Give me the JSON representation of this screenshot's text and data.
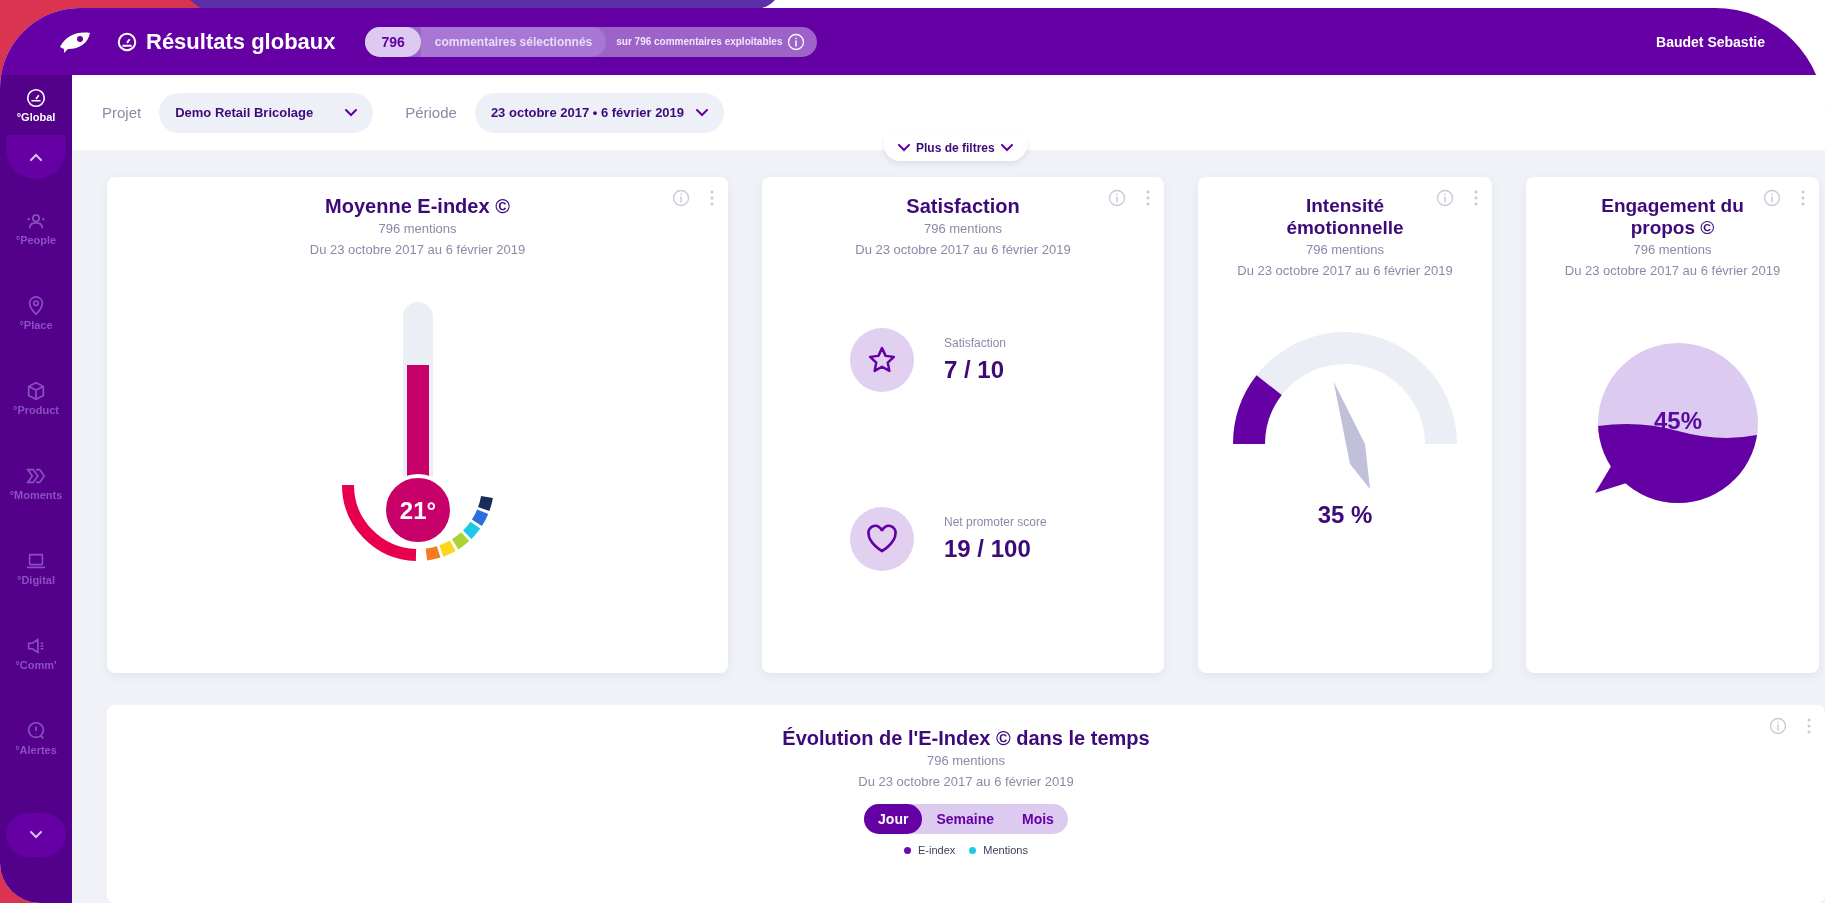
{
  "header": {
    "title": "Résultats globaux",
    "count": "796",
    "count_label": "commentaires sélectionnés",
    "total": "sur 796 commentaires exploitables",
    "user": "Baudet Sebastie"
  },
  "sidebar": {
    "items": [
      {
        "label": "°Global",
        "selected": true
      },
      {
        "label": "°People",
        "selected": false
      },
      {
        "label": "°Place",
        "selected": false
      },
      {
        "label": "°Product",
        "selected": false
      },
      {
        "label": "°Moments",
        "selected": false
      },
      {
        "label": "°Digital",
        "selected": false
      },
      {
        "label": "°Comm'",
        "selected": false
      },
      {
        "label": "°Alertes",
        "selected": false
      }
    ]
  },
  "filters": [
    {
      "label": "Projet",
      "value": "Demo Retail Bricolage"
    },
    {
      "label": "Période",
      "value": "23 octobre 2017 • 6 février 2019"
    }
  ],
  "more_filters": "Plus de filtres",
  "cards": [
    {
      "kind": "thermometer",
      "title": "Moyenne E-index ©",
      "mentions": "796 mentions",
      "period": "Du 23 octobre 2017 au 6 février 2019",
      "value": "21°"
    },
    {
      "kind": "scores",
      "title": "Satisfaction",
      "mentions": "796 mentions",
      "period": "Du 23 octobre 2017 au 6 février 2019",
      "scores": [
        {
          "label": "Satisfaction",
          "value": "7 / 10"
        },
        {
          "label": "Net promoter score",
          "value": "19 / 100"
        }
      ]
    },
    {
      "kind": "gauge",
      "title": "Intensité émotionnelle",
      "mentions": "796 mentions",
      "period": "Du 23 octobre 2017 au 6 février 2019",
      "value": "35 %"
    },
    {
      "kind": "bubble",
      "title": "Engagement du propos ©",
      "mentions": "796 mentions",
      "period": "Du 23 octobre 2017 au 6 février 2019",
      "value": "45%"
    }
  ],
  "evolution": {
    "title": "Évolution de l'E-Index © dans le temps",
    "mentions": "796 mentions",
    "period": "Du 23 octobre 2017 au 6 février 2019",
    "toggle": [
      {
        "label": "Jour",
        "selected": true
      },
      {
        "label": "Semaine",
        "selected": false
      },
      {
        "label": "Mois",
        "selected": false
      }
    ],
    "legend": [
      {
        "label": "E-index",
        "color": "#6a0dad"
      },
      {
        "label": "Mentions",
        "color": "#1ec8e6"
      }
    ]
  }
}
